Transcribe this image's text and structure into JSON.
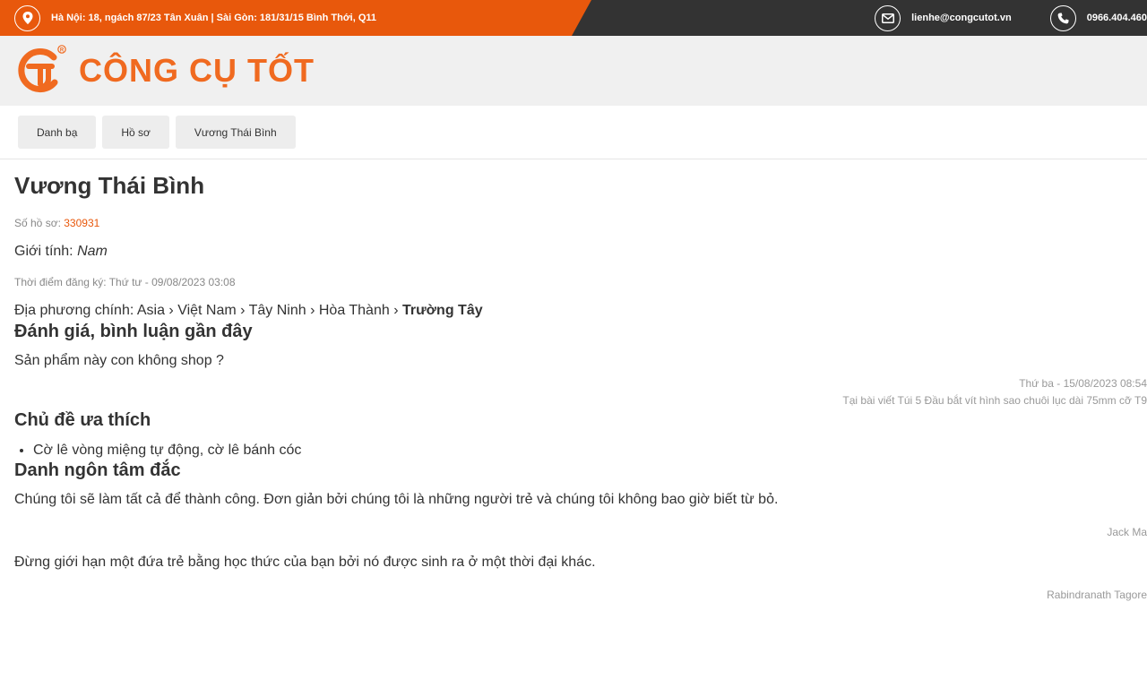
{
  "topbar": {
    "address": "Hà Nội: 18, ngách 87/23 Tân Xuân | Sài Gòn: 181/31/15 Bình Thới, Q11",
    "email": "lienhe@congcutot.vn",
    "phone": "0966.404.460",
    "icons": {
      "location": "map-pin-icon",
      "email": "envelope-icon",
      "phone": "phone-icon"
    },
    "colors": {
      "accent": "#e8580c",
      "dark": "#333333"
    }
  },
  "header": {
    "logo_text": "CÔNG CỤ TỐT",
    "logo_color": "#f06a20"
  },
  "breadcrumb": [
    {
      "label": "Danh bạ"
    },
    {
      "label": "Hồ sơ"
    },
    {
      "label": "Vương Thái Bình"
    }
  ],
  "profile": {
    "name": "Vương Thái Bình",
    "id_label": "Số hồ sơ:",
    "id_value": "330931",
    "gender_label": "Giới tính:",
    "gender_value": "Nam",
    "registered": "Thời điểm đăng ký: Thứ tư - 09/08/2023 03:08",
    "location_label": "Địa phương chính:",
    "location_path": "Asia › Việt Nam › Tây Ninh › Hòa Thành ›",
    "location_last": "Trường Tây"
  },
  "reviews": {
    "title": "Đánh giá, bình luận gần đây",
    "items": [
      {
        "text": "Sản phẩm này con không shop ?",
        "date": "Thứ ba - 15/08/2023 08:54",
        "source": "Tại bài viết Túi 5 Đầu bắt vít hình sao chuôi lục dài 75mm cỡ T9"
      }
    ]
  },
  "topics": {
    "title": "Chủ đề ưa thích",
    "items": [
      "Cờ lê vòng miệng tự động, cờ lê bánh cóc"
    ]
  },
  "quotes": {
    "title": "Danh ngôn tâm đắc",
    "items": [
      {
        "text": "Chúng tôi sẽ làm tất cả để thành công. Đơn giản bởi chúng tôi là những người trẻ và chúng tôi không bao giờ biết từ bỏ.",
        "author": "Jack Ma"
      },
      {
        "text": "Đừng giới hạn một đứa trẻ bằng học thức của bạn bởi nó được sinh ra ở một thời đại khác.",
        "author": "Rabindranath Tagore"
      }
    ]
  }
}
